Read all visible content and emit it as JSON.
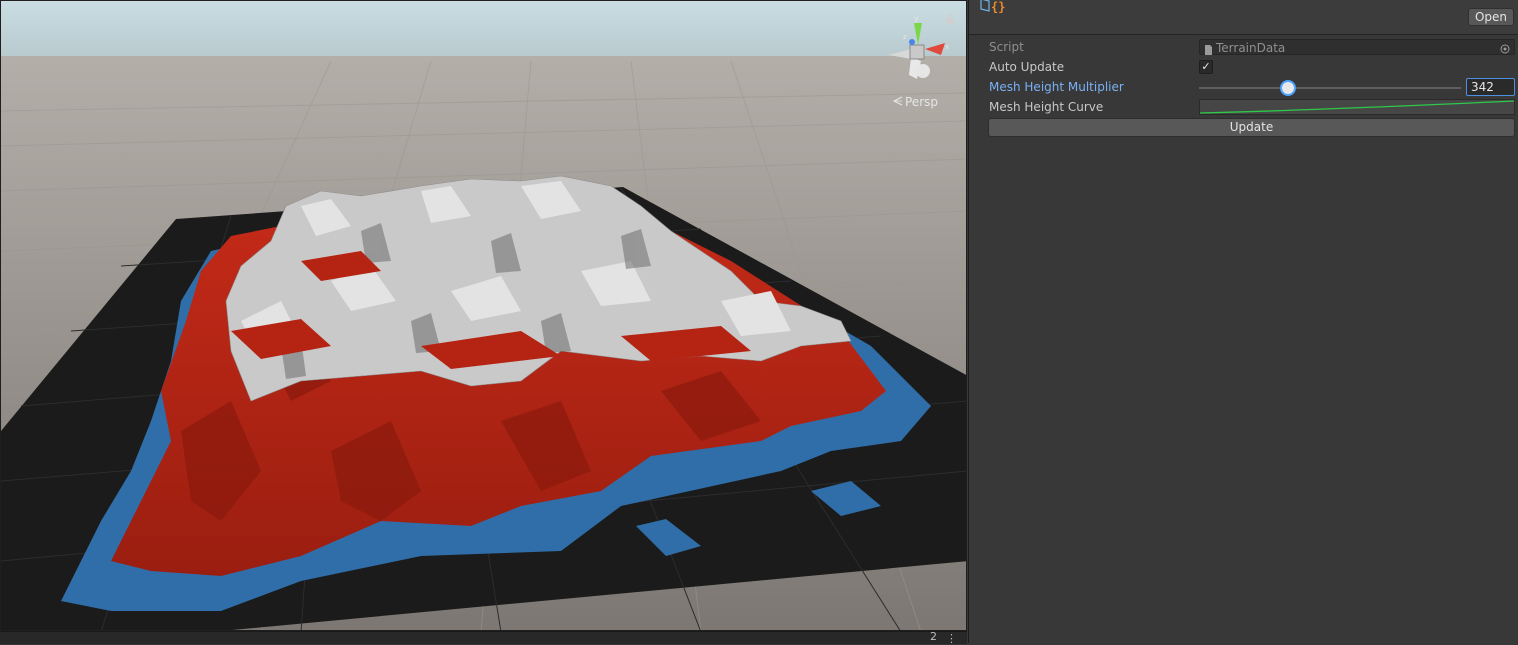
{
  "scene": {
    "view_mode": "Persp",
    "gizmo_axis_label": "y",
    "footer_count": "2",
    "colors": {
      "water": "#2f6ea9",
      "land": "#b82516",
      "snow": "#c8c8c8",
      "plane": "#1a1a1a",
      "ground": "#8a8480",
      "sky": "#c3d8de"
    }
  },
  "inspector": {
    "header_icon": "script-asset-icon",
    "open_button": "Open",
    "fields": {
      "script": {
        "label": "Script",
        "value": "TerrainData"
      },
      "auto_update": {
        "label": "Auto Update",
        "checked": true
      },
      "mesh_height_multiplier": {
        "label": "Mesh Height Multiplier",
        "value": "342",
        "slider_fraction": 0.34
      },
      "mesh_height_curve": {
        "label": "Mesh Height Curve",
        "curve_color": "#2ec84a"
      }
    },
    "update_button": "Update"
  }
}
